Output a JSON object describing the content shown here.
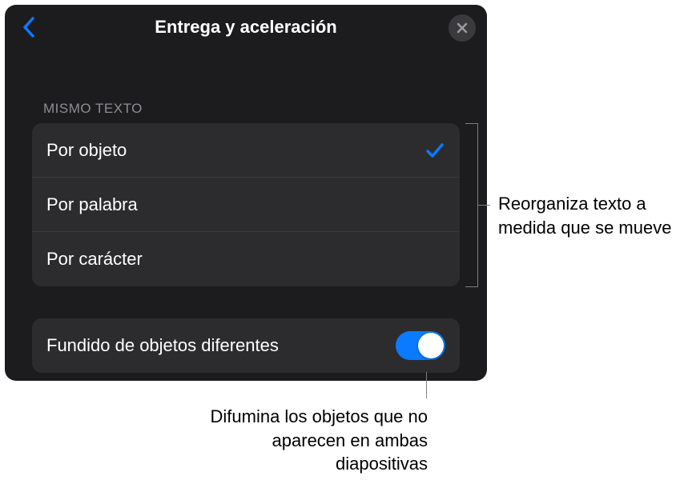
{
  "header": {
    "title": "Entrega y aceleración"
  },
  "section": {
    "header": "MISMO TEXTO",
    "items": [
      {
        "label": "Por objeto",
        "selected": true
      },
      {
        "label": "Por palabra",
        "selected": false
      },
      {
        "label": "Por carácter",
        "selected": false
      }
    ]
  },
  "toggle": {
    "label": "Fundido de objetos diferentes",
    "on": true
  },
  "callouts": {
    "right": "Reorganiza texto a medida que se mueve",
    "bottom": "Difumina los objetos que no aparecen en ambas diapositivas"
  }
}
